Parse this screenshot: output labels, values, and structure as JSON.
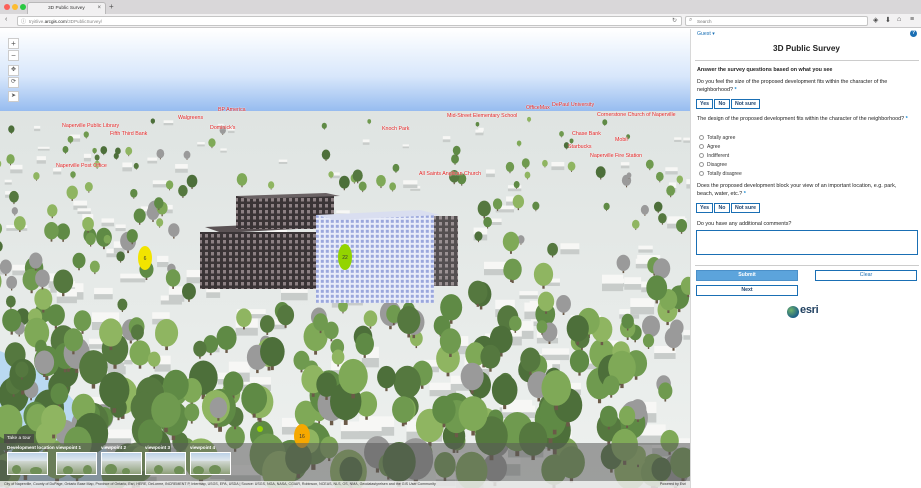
{
  "browser": {
    "tab_title": "3D Public Survey",
    "url_prefix": "tryitlive.",
    "url_domain": "arcgis.com",
    "url_path": "/3DPublicSurvey/",
    "search_placeholder": "Search",
    "icons": [
      "back-icon",
      "info-icon",
      "reload-icon",
      "search-icon",
      "pocket-icon",
      "download-icon",
      "home-icon",
      "menu-icon"
    ]
  },
  "scene": {
    "poi_labels": [
      "BP America",
      "OfficeMax",
      "DePaul University",
      "Mid-Street Elementary School",
      "All Saints Anglican Church",
      "Cornerstone Church of Naperville",
      "Naperville Public Library",
      "Fifth Third Bank",
      "Walgreens",
      "Dominick's",
      "Naperville Post Office",
      "Knoch Park",
      "Chase Bank",
      "Starbucks",
      "Mobil",
      "Naperville Fire Station"
    ],
    "markers": [
      "6",
      "22",
      "16"
    ],
    "tour": {
      "label": "Take a tour",
      "viewpoints": [
        "Development location",
        "viewpoint 1",
        "viewpoint 2",
        "viewpoint 3",
        "viewpoint 4"
      ]
    },
    "attribution": "City of Naperville, County of DuPage, Ontario Base Map, Province of Ontario, Esri, HERE, DeLorme, INCREMENT P, Intermap, USGS, EPA, USDA | Source: USGS, NGA, NASA, CGIAR, Robinson, NCEAS, NLS, OS, NMA, Geodatastyrelsen and the GIS User Community",
    "powered_by": "Powered by Esri",
    "colors": {
      "label": "#e02020",
      "building_new": "#3a3a3a",
      "building_glass": "#c9d1ef",
      "tree": "#6f8f56",
      "marker_yellow": "#f2e400",
      "marker_green": "#93d400",
      "marker_orange": "#f6a800"
    }
  },
  "panel": {
    "guest": "Guest",
    "title": "3D Public Survey",
    "intro": "Answer the survey questions based on what you see",
    "q1": "Do you feel the size of the proposed development fits within the character of the neighborhood?",
    "q2": "The design of the proposed development fits within the character of the neighborhood?",
    "q2_options": [
      "Totally agree",
      "Agree",
      "Indifferent",
      "Disagree",
      "Totally disagree"
    ],
    "q3": "Does the proposed development block your view of an important location, e.g. park, beach, water, etc.?",
    "q4": "Do you have any additional comments?",
    "yes": "Yes",
    "no": "No",
    "not_sure": "Not sure",
    "required_mark": "*",
    "submit": "Submit",
    "clear": "Clear",
    "next": "Next",
    "logo": "esri",
    "accent": "#1a6fb4"
  }
}
